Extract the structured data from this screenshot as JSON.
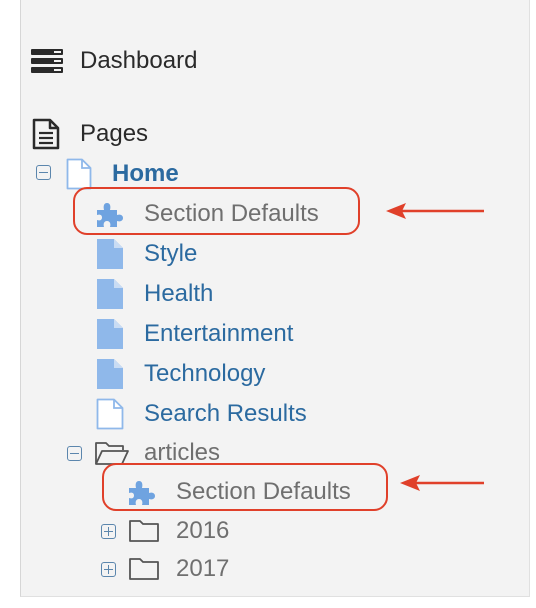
{
  "nav": {
    "dashboard": {
      "label": "Dashboard",
      "icon": "dashboard-icon"
    },
    "pages": {
      "label": "Pages",
      "icon": "document-icon"
    }
  },
  "tree": {
    "home": {
      "label": "Home",
      "icon": "page-outline-icon"
    },
    "home_children": [
      {
        "label": "Section Defaults",
        "icon": "puzzle-icon"
      },
      {
        "label": "Style",
        "icon": "page-filled-icon"
      },
      {
        "label": "Health",
        "icon": "page-filled-icon"
      },
      {
        "label": "Entertainment",
        "icon": "page-filled-icon"
      },
      {
        "label": "Technology",
        "icon": "page-filled-icon"
      },
      {
        "label": "Search Results",
        "icon": "page-outline-icon"
      }
    ],
    "articles": {
      "label": "articles",
      "icon": "folder-open-icon"
    },
    "articles_children": [
      {
        "label": "Section Defaults",
        "icon": "puzzle-icon"
      },
      {
        "label": "2016",
        "icon": "folder-icon"
      },
      {
        "label": "2017",
        "icon": "folder-icon"
      }
    ]
  },
  "colors": {
    "link": "#2b6aa0",
    "muted": "#6f6f6f",
    "highlight": "#e0402a",
    "page_icon": "#8fb8ea"
  }
}
